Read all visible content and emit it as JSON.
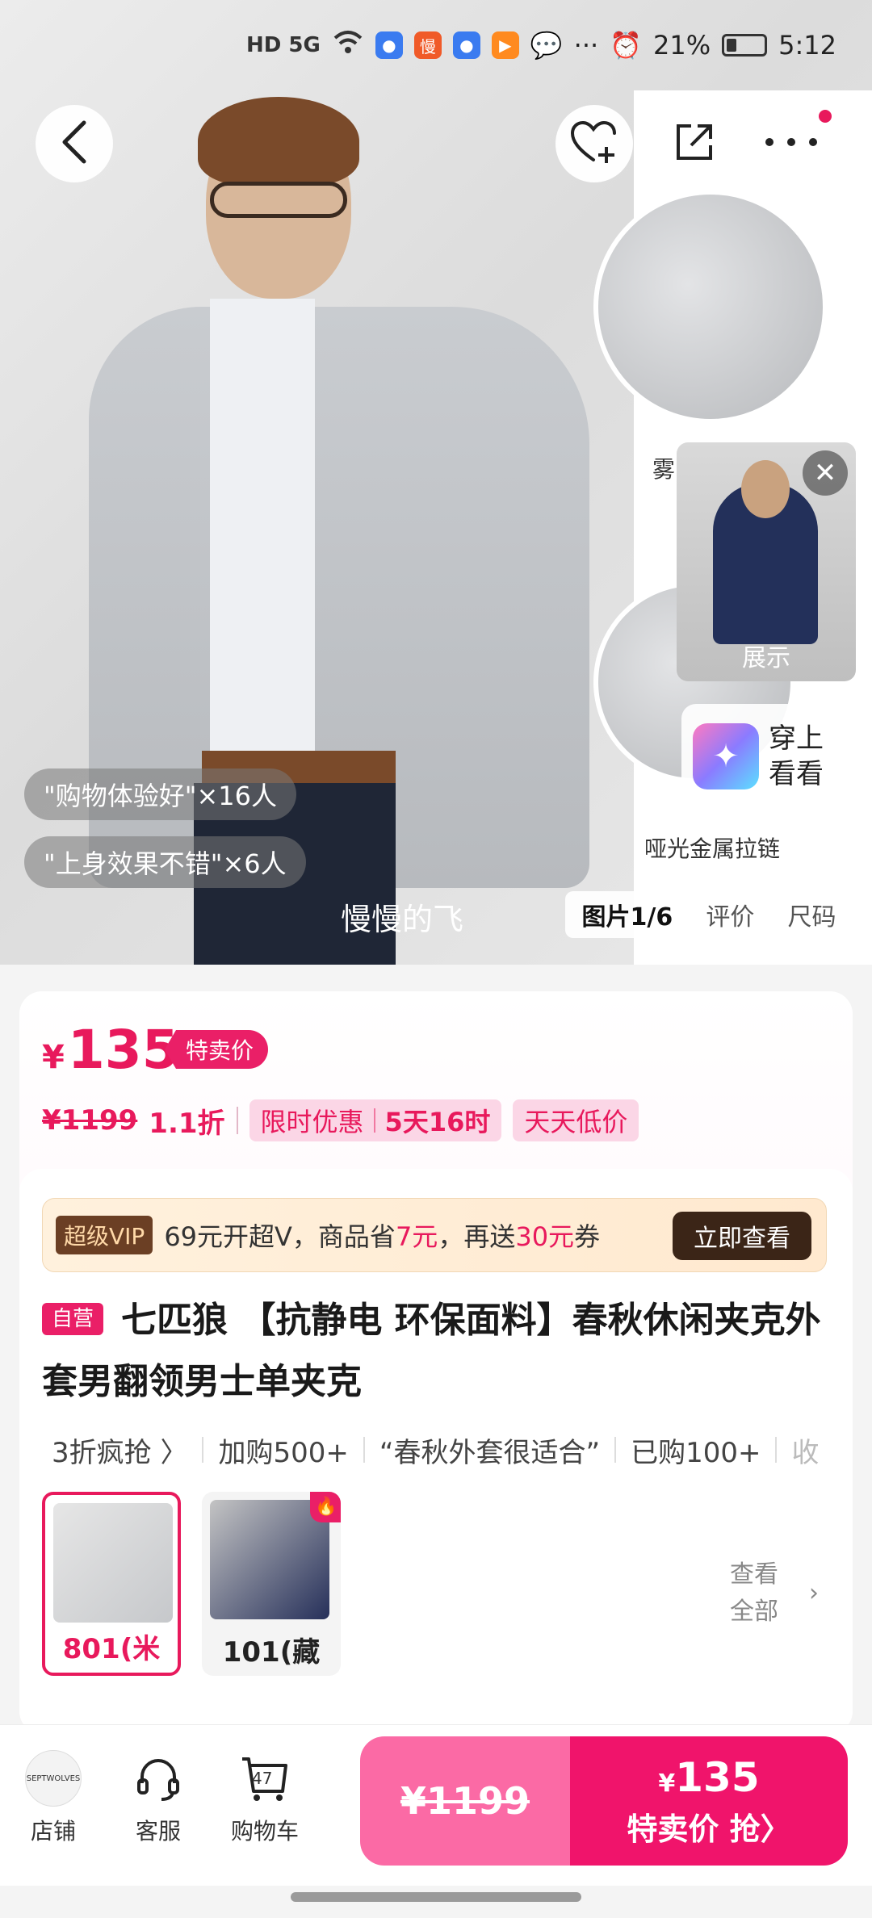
{
  "status_bar": {
    "network": "HD 5G",
    "app_icons": [
      "blue-app",
      "manman-app",
      "blue-app",
      "video-app",
      "message-app"
    ],
    "more": "···",
    "battery_percent": "21%",
    "time": "5:12"
  },
  "gallery": {
    "icons": {
      "back": "back-icon",
      "favorite": "heart-plus-icon",
      "share": "share-icon",
      "more": "more-icon"
    },
    "caption_zip": "哑光金属拉链",
    "caption_fog": "雾",
    "video_card_label": "展示",
    "try_on": "穿上看看",
    "review_chips": [
      "\"购物体验好\"×16人",
      "\"上身效果不错\"×6人"
    ],
    "watermark": "慢慢的飞",
    "tabs": [
      "图片1/6",
      "评价",
      "尺码"
    ]
  },
  "price": {
    "currency": "¥",
    "current": "135",
    "badge": "特卖价",
    "original": "¥1199",
    "discount": "1.1折",
    "promo_limited": "限时优惠",
    "promo_countdown": "5天16时",
    "promo_low": "天天低价"
  },
  "vip": {
    "tag": "超级VIP",
    "text_a": "69元开超V，商品省",
    "text_b": "7元",
    "text_c": "，再送",
    "text_d": "30元",
    "text_e": "券",
    "button": "立即查看"
  },
  "product": {
    "self_tag": "自营",
    "title": "七匹狼 【抗静电 环保面料】春秋休闲夹克外套男翻领男士单夹克",
    "features": [
      "3折疯抢 〉",
      "加购500+",
      "“春秋外套很适合”",
      "已购100+",
      "收"
    ]
  },
  "variants": [
    {
      "label": "801(米",
      "selected": true
    },
    {
      "label": "101(藏",
      "selected": false,
      "hot": true
    }
  ],
  "view_all": "查看全部",
  "bottom": {
    "store_logo": "SEPTWOLVES",
    "store": "店铺",
    "service": "客服",
    "cart": "购物车",
    "cart_count": "47",
    "original_price": "¥1199",
    "buy_price_currency": "¥",
    "buy_price": "135",
    "buy_label": "特卖价 抢〉"
  },
  "colors": {
    "accent": "#e8195c",
    "buy_button": "#f0146b",
    "orig_button": "#fb6aa5"
  }
}
